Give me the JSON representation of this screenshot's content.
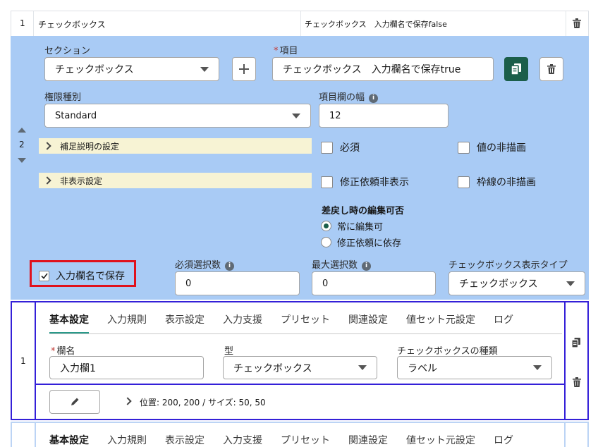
{
  "top_row": {
    "index": "1",
    "name": "チェックボックス",
    "description": "チェックボックス　入力欄名で保存false"
  },
  "editor": {
    "index": "2",
    "section": {
      "label": "セクション",
      "value": "チェックボックス"
    },
    "item": {
      "label": "項目",
      "value": "チェックボックス　入力欄名で保存true"
    },
    "permission": {
      "label": "権限種別",
      "value": "Standard"
    },
    "width": {
      "label": "項目欄の幅",
      "value": "12"
    },
    "accordion_help": "補足説明の設定",
    "accordion_hidden": "非表示設定",
    "checkboxes": {
      "required": "必須",
      "no_value_render": "値の非描画",
      "hide_on_fix_request": "修正依頼非表示",
      "no_border_render": "枠線の非描画"
    },
    "edit_on_return": {
      "label": "差戻し時の編集可否",
      "options": [
        "常に編集可",
        "修正依頼に依存"
      ],
      "selected": 0
    },
    "save_as_name": "入力欄名で保存",
    "min_select": {
      "label": "必須選択数",
      "value": "0"
    },
    "max_select": {
      "label": "最大選択数",
      "value": "0"
    },
    "display_type": {
      "label": "チェックボックス表示タイプ",
      "value": "チェックボックス"
    }
  },
  "tabs": [
    "基本設定",
    "入力規則",
    "表示設定",
    "入力支援",
    "プリセット",
    "関連設定",
    "値セット元設定",
    "ログ"
  ],
  "sub_item": {
    "index": "1",
    "name": {
      "label": "欄名",
      "value": "入力欄1"
    },
    "type": {
      "label": "型",
      "value": "チェックボックス"
    },
    "cb_type": {
      "label": "チェックボックスの種類",
      "value": "ラベル"
    },
    "position_text": "位置: 200, 200 / サイズ: 50, 50"
  },
  "colors": {
    "accent": "#1b5e4a",
    "highlight": "#e0111c",
    "panel_border": "#3420d8",
    "editor_bg": "#a9cbf5"
  }
}
